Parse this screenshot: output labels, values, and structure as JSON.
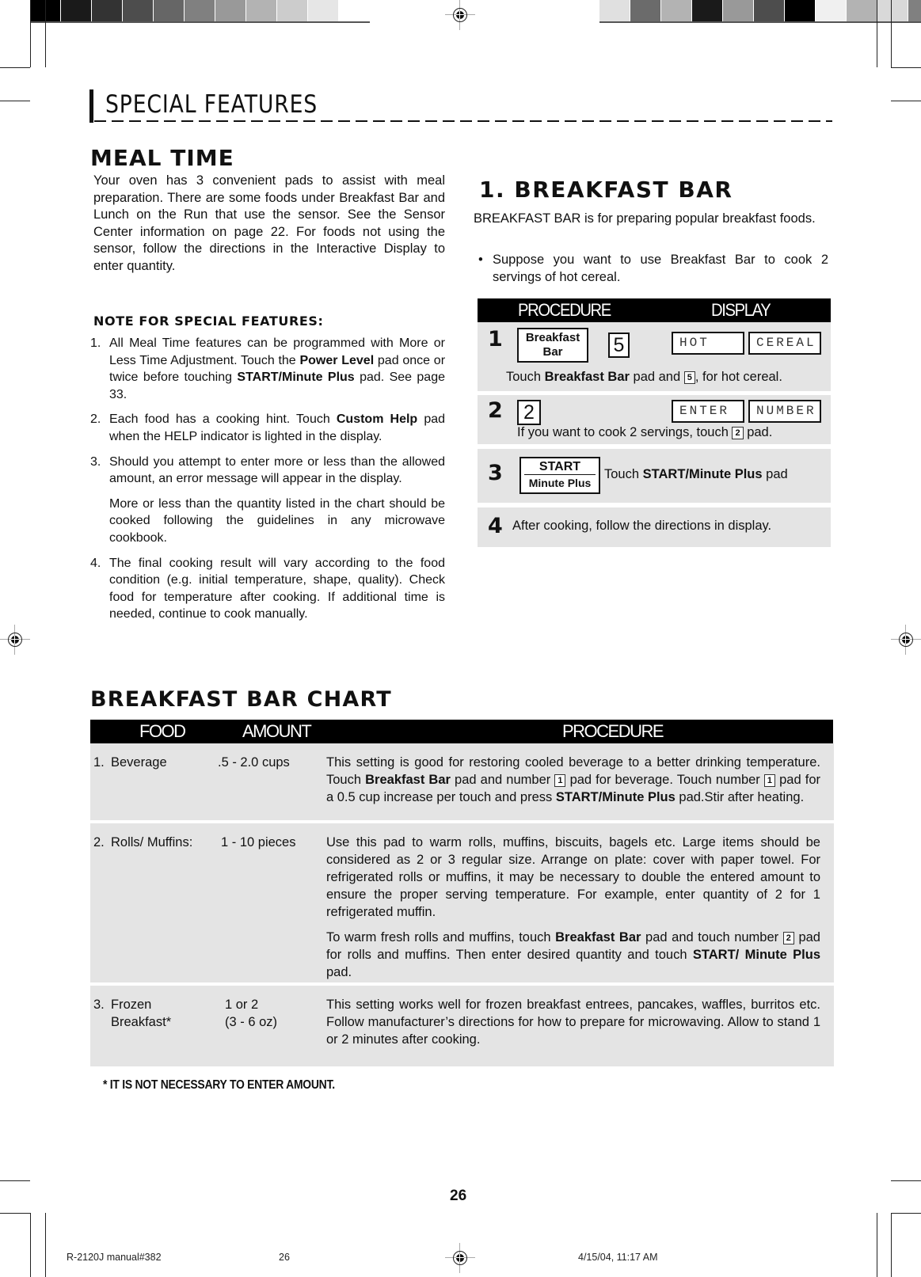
{
  "printer_marks": {
    "left_colorbar": [
      "#000000",
      "#1a1a1a",
      "#333333",
      "#4d4d4d",
      "#666666",
      "#808080",
      "#999999",
      "#b3b3b3",
      "#cccccc",
      "#e6e6e6",
      "#ffffff"
    ],
    "right_colorbar": [
      "#e0e0e0",
      "#6b6b6b",
      "#b3b3b3",
      "#1a1a1a",
      "#999999",
      "#4d4d4d",
      "#000000",
      "#f0f0f0",
      "#b3b3b3",
      "#d9d9d9",
      "#808080"
    ]
  },
  "section": {
    "title": "SPECIAL FEATURES"
  },
  "meal_time": {
    "heading": "MEAL TIME",
    "intro": "Your oven has 3 convenient pads to assist with meal preparation. There are some foods under Breakfast Bar and Lunch on the Run that use the sensor. See the Sensor Center information on page 22. For foods not using the sensor, follow the directions in the Interactive Display to enter quantity."
  },
  "notes": {
    "heading": "NOTE FOR SPECIAL FEATURES:",
    "items": [
      {
        "num": "1.",
        "parts": [
          "All Meal Time features can be programmed with More or Less Time Adjustment. Touch the ",
          "Power Level",
          " pad once or twice before touching ",
          "START/Minute Plus",
          " pad. See page 33."
        ]
      },
      {
        "num": "2.",
        "parts": [
          "Each food has a cooking hint. Touch ",
          "Custom Help",
          " pad when the HELP indicator is lighted in the display."
        ]
      },
      {
        "num": "3.",
        "text": "Should you attempt to enter more or less than the allowed amount, an error message will appear in the display.",
        "text2": "More or less than the quantity listed in the chart should be cooked following the guidelines in any microwave cookbook."
      },
      {
        "num": "4.",
        "text": "The final cooking result will vary according to the food condition (e.g. initial temperature, shape, quality). Check food for temperature after cooking. If additional time is needed, continue to cook manually."
      }
    ]
  },
  "breakfast_bar": {
    "heading": "1. BREAKFAST BAR",
    "intro": "BREAKFAST BAR is for preparing popular breakfast foods.",
    "bullet_symbol": "•",
    "bullet": "Suppose you want to use Breakfast Bar to cook 2 servings of hot cereal.",
    "table_headers": {
      "procedure": "PROCEDURE",
      "display": "DISPLAY"
    },
    "steps": [
      {
        "num": "1",
        "pad_line1": "Breakfast",
        "pad_line2": "Bar",
        "key": "5",
        "display": [
          "HOT",
          "CEREAL"
        ],
        "text_before": "Touch ",
        "text_bold": "Breakfast Bar",
        "text_mid": " pad and ",
        "text_key": "5",
        "text_after": ", for hot cereal."
      },
      {
        "num": "2",
        "key": "2",
        "display": [
          "ENTER",
          "NUMBER"
        ],
        "text_before": "If you want to cook 2 servings, touch ",
        "text_key": "2",
        "text_after": " pad."
      },
      {
        "num": "3",
        "pad_line1": "START",
        "pad_line2": "Minute Plus",
        "text_before": "Touch ",
        "text_bold": "START/Minute Plus",
        "text_after": " pad"
      },
      {
        "num": "4",
        "text": "After cooking, follow the directions in display."
      }
    ]
  },
  "chart": {
    "heading": "BREAKFAST BAR CHART",
    "headers": {
      "food": "FOOD",
      "amount": "AMOUNT",
      "procedure": "PROCEDURE"
    },
    "rows": [
      {
        "num": "1.",
        "food": "Beverage",
        "amount": ".5 - 2.0 cups",
        "procedure": {
          "p1": "This setting is good for restoring cooled beverage to a better drinking temperature. Touch ",
          "b1": "Breakfast Bar",
          "p2": " pad and number ",
          "k1": "1",
          "p3": " pad for beverage. Touch number ",
          "k2": "1",
          "p4": " pad for a 0.5 cup increase per touch and press ",
          "b2": "START/Minute Plus",
          "p5": " pad.Stir after heating."
        }
      },
      {
        "num": "2.",
        "food": "Rolls/ Muffins:",
        "amount": "1 - 10 pieces",
        "procedure": {
          "para1": "Use this pad to warm rolls, muffins, biscuits, bagels etc. Large items should be considered as 2 or 3 regular size. Arrange on plate: cover with paper towel. For refrigerated rolls or muffins, it may be necessary to double the entered amount to ensure the proper serving temperature. For example, enter quantity of 2 for 1 refrigerated muffin.",
          "p1": "To warm fresh rolls and muffins, touch ",
          "b1": "Breakfast Bar",
          "p2": " pad and touch number ",
          "k1": "2",
          "p3": " pad for rolls and muffins. Then enter desired quantity and touch ",
          "b2": "START/ Minute Plus",
          "p4": " pad."
        }
      },
      {
        "num": "3.",
        "food": "Frozen",
        "food_line2": "Breakfast*",
        "amount": "1 or 2",
        "amount_line2": "(3 - 6 oz)",
        "procedure": {
          "text": "This setting works well for frozen breakfast entrees, pancakes, waffles, burritos etc. Follow manufacturer’s directions for how to prepare for microwaving. Allow to stand 1 or 2 minutes after cooking."
        }
      }
    ],
    "footnote": "* IT IS NOT NECESSARY TO ENTER AMOUNT."
  },
  "footer": {
    "page_number": "26",
    "slug_file": "R-2120J manual#382",
    "slug_page": "26",
    "slug_date": "4/15/04, 11:17 AM"
  }
}
